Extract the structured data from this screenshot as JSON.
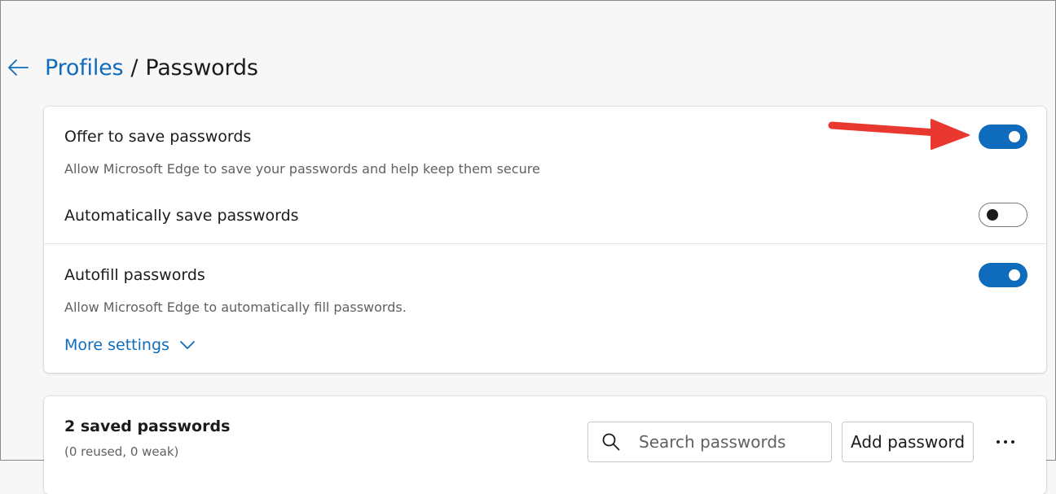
{
  "header": {
    "breadcrumb_parent": "Profiles",
    "separator": "/",
    "breadcrumb_current": "Passwords"
  },
  "settings": {
    "offer_save": {
      "title": "Offer to save passwords",
      "description": "Allow Microsoft Edge to save your passwords and help keep them secure",
      "enabled": true
    },
    "auto_save": {
      "title": "Automatically save passwords",
      "enabled": false
    },
    "autofill": {
      "title": "Autofill passwords",
      "description": "Allow Microsoft Edge to automatically fill passwords.",
      "enabled": true
    },
    "more_settings_label": "More settings"
  },
  "saved": {
    "title": "2 saved passwords",
    "subtitle": "(0 reused, 0 weak)",
    "search_placeholder": "Search passwords",
    "add_button": "Add password"
  },
  "icons": {
    "back": "arrow-left-icon",
    "chevron": "chevron-down-icon",
    "search": "search-icon",
    "more": "more-horizontal-icon",
    "annotation": "red-arrow-annotation"
  },
  "colors": {
    "accent": "#0f6cbd",
    "annotation_arrow": "#e8382f"
  }
}
